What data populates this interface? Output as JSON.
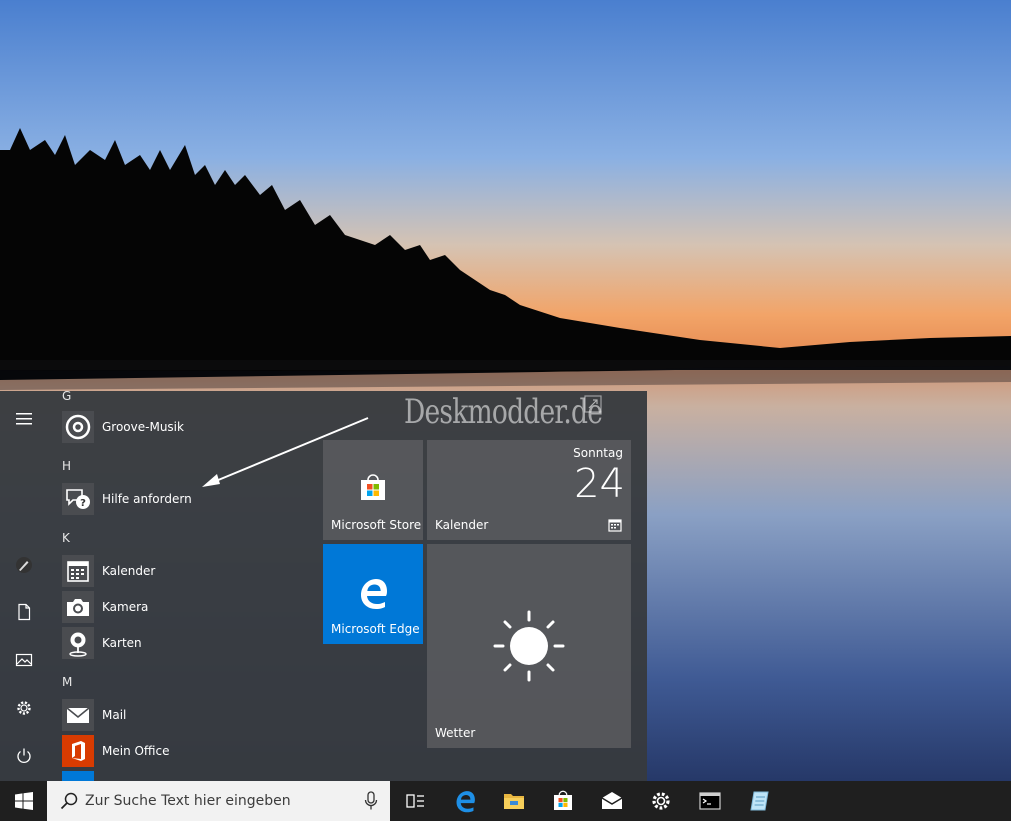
{
  "watermark": "Deskmodder.de",
  "app_list": {
    "letters": [
      "G",
      "H",
      "K",
      "M"
    ],
    "apps": [
      {
        "label": "Groove-Musik",
        "icon": "groove-music-icon"
      },
      {
        "label": "Hilfe anfordern",
        "icon": "help-chat-icon"
      },
      {
        "label": "Kalender",
        "icon": "calendar-icon"
      },
      {
        "label": "Kamera",
        "icon": "camera-icon"
      },
      {
        "label": "Karten",
        "icon": "maps-icon"
      },
      {
        "label": "Mail",
        "icon": "mail-icon"
      },
      {
        "label": "Mein Office",
        "icon": "office-icon"
      }
    ]
  },
  "rail": [
    "hamburger-menu-icon",
    "pen-icon",
    "documents-icon",
    "pictures-icon",
    "settings-icon",
    "power-icon"
  ],
  "tiles": {
    "store": {
      "label": "Microsoft Store"
    },
    "calendar": {
      "label": "Kalender",
      "day_name": "Sonntag",
      "day_number": "24"
    },
    "edge": {
      "label": "Microsoft Edge",
      "color": "#0078d7"
    },
    "weather": {
      "label": "Wetter"
    }
  },
  "taskbar": {
    "search_placeholder": "Zur Suche Text hier eingeben",
    "pinned": [
      "task-view-icon",
      "edge-icon",
      "file-explorer-icon",
      "store-icon",
      "mail-icon",
      "settings-icon",
      "command-prompt-icon",
      "notepad-icon"
    ]
  }
}
